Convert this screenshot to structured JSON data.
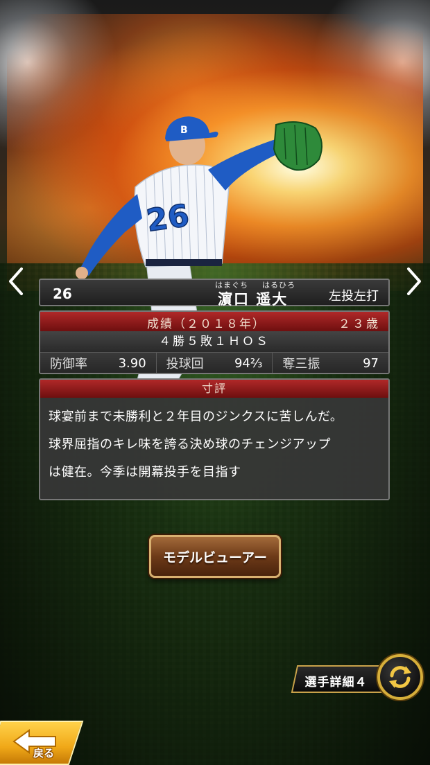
{
  "player": {
    "number": "26",
    "name_ruby_family": "はまぐち",
    "name_ruby_given": "はるひろ",
    "name": "濵口 遥大",
    "handedness": "左投左打",
    "jersey_number_display": "26"
  },
  "stats": {
    "season_label": "成績（２０１８年）",
    "age": "２３歳",
    "record": "４勝５敗１ＨＯＳ",
    "era_label": "防御率",
    "era_value": "3.90",
    "innings_label": "投球回",
    "innings_value": "94⅔",
    "strikeouts_label": "奪三振",
    "strikeouts_value": "97"
  },
  "review": {
    "title": "寸評",
    "lines": [
      "球宴前まで未勝利と２年目のジンクスに苦しんだ。",
      "球界屈指のキレ味を誇る決め球のチェンジアップ",
      "は健在。今季は開幕投手を目指す"
    ]
  },
  "buttons": {
    "model_viewer": "モデルビューアー",
    "player_detail": "選手詳細４",
    "back": "戻る"
  },
  "icons": {
    "prev": "chevron-left-icon",
    "next": "chevron-right-icon",
    "switch": "switch-arrows-icon",
    "back": "back-arrow-icon"
  },
  "colors": {
    "header_red": "#b02828",
    "gold": "#d6ae3a",
    "uniform_blue": "#1f5cc4"
  }
}
